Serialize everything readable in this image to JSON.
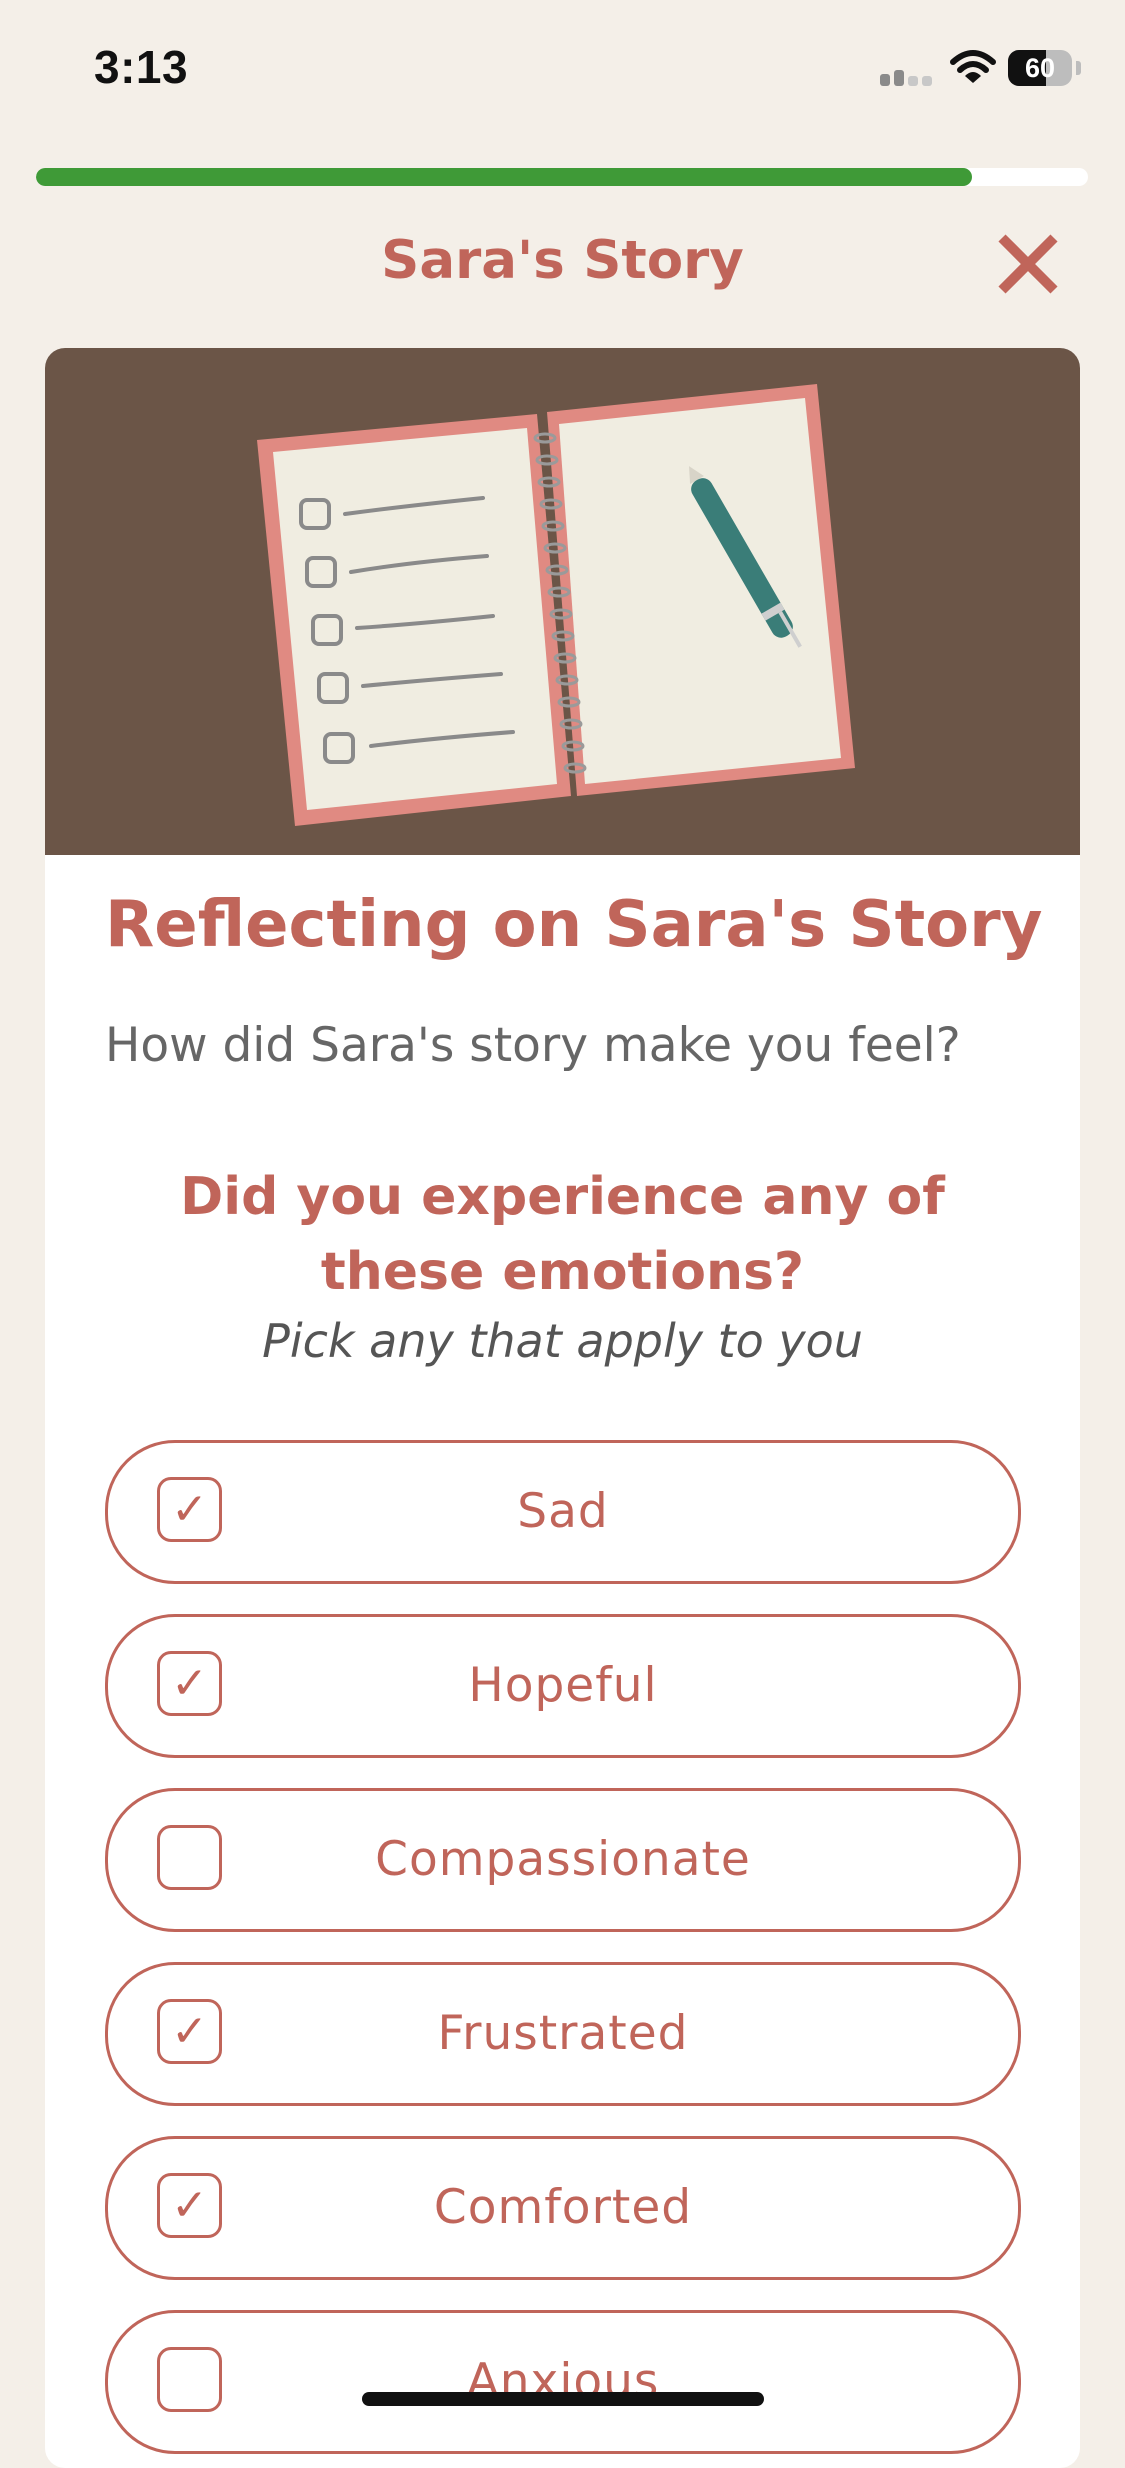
{
  "status": {
    "time": "3:13",
    "battery_percent": 60,
    "battery_label": "60"
  },
  "progress": {
    "fraction": 0.89,
    "color": "#3f9a37"
  },
  "header": {
    "title": "Sara's Story",
    "close_icon": "close-icon"
  },
  "card": {
    "title": "Reflecting on Sara's Story",
    "prompt": "How did Sara's story make you feel?",
    "question": "Did you experience any of these emotions?",
    "hint": "Pick any that apply to you",
    "options": [
      {
        "label": "Sad",
        "checked": true
      },
      {
        "label": "Hopeful",
        "checked": true
      },
      {
        "label": "Compassionate",
        "checked": false
      },
      {
        "label": "Frustrated",
        "checked": true
      },
      {
        "label": "Comforted",
        "checked": true
      },
      {
        "label": "Anxious",
        "checked": false
      }
    ]
  },
  "colors": {
    "accent": "#c0655a",
    "background": "#f4efe8",
    "hero_background": "#6b5547"
  }
}
